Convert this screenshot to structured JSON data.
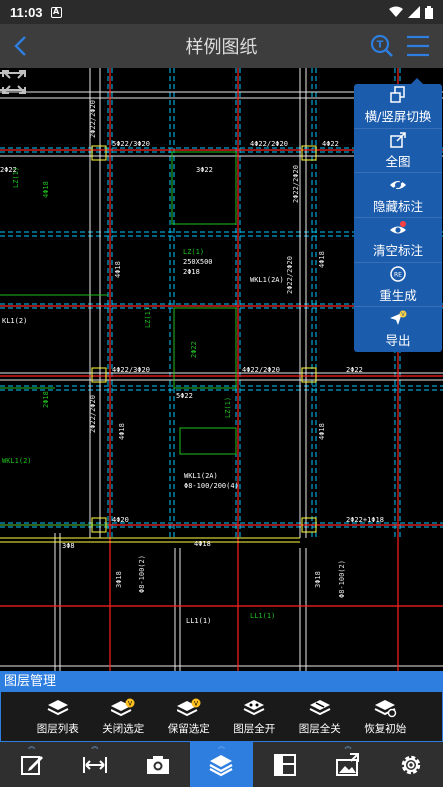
{
  "status_bar": {
    "time": "11:03",
    "notif_letter": "A"
  },
  "title_bar": {
    "title": "样例图纸"
  },
  "colors": {
    "accent": "#2e7ee0",
    "popup": "#1c5cad",
    "cad_grid": "#00d0ff",
    "cad_red": "#ff2020",
    "cad_green": "#20c020",
    "cad_yellow": "#ffff40"
  },
  "popup_menu": {
    "items": [
      {
        "label": "横/竖屏切换",
        "icon": "rotate-screen-icon"
      },
      {
        "label": "全图",
        "icon": "fit-all-icon"
      },
      {
        "label": "隐藏标注",
        "icon": "eye-off-icon"
      },
      {
        "label": "清空标注",
        "icon": "eye-clear-icon"
      },
      {
        "label": "重生成",
        "icon": "regenerate-icon"
      },
      {
        "label": "导出",
        "icon": "export-icon"
      }
    ]
  },
  "layer_panel": {
    "title": "图层管理",
    "buttons": [
      {
        "label": "图层列表",
        "icon": "layers-list-icon"
      },
      {
        "label": "关闭选定",
        "icon": "layers-close-selected-icon"
      },
      {
        "label": "保留选定",
        "icon": "layers-keep-selected-icon"
      },
      {
        "label": "图层全开",
        "icon": "layers-all-on-icon"
      },
      {
        "label": "图层全关",
        "icon": "layers-all-off-icon"
      },
      {
        "label": "恢复初始",
        "icon": "layers-reset-icon"
      }
    ]
  },
  "toolbar": {
    "tools": [
      {
        "icon": "edit-icon",
        "active": false
      },
      {
        "icon": "measure-icon",
        "active": false
      },
      {
        "icon": "camera-icon",
        "active": false
      },
      {
        "icon": "layers-icon",
        "active": true
      },
      {
        "icon": "layout-icon",
        "active": false
      },
      {
        "icon": "image-export-icon",
        "active": false
      },
      {
        "icon": "settings-icon",
        "active": false
      }
    ]
  },
  "drawing_labels": {
    "beam_labels": [
      "5Φ22/3Φ20",
      "3Φ22",
      "4Φ22/2Φ20",
      "4Φ22",
      "2Φ22",
      "4Φ22/3Φ20",
      "5Φ22",
      "4Φ22/2Φ20",
      "2Φ22",
      "4Φ20",
      "2Φ22+1Φ18",
      "4Φ18"
    ],
    "column_labels": [
      "LZ(1)",
      "250X500",
      "2Φ18",
      "WKL1(2A)",
      "Φ8-100/200(4)",
      "LL1(1)",
      "KL1(2)",
      "WKL1(2A)",
      "WKL1(2)",
      "LL1(1)"
    ],
    "grid_label": "3Φ8"
  }
}
